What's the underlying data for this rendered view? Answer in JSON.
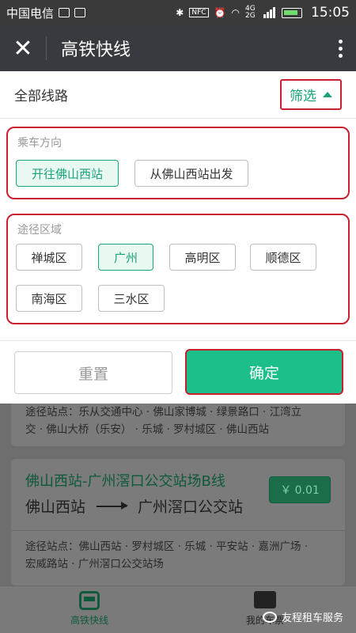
{
  "statusbar": {
    "carrier": "中国电信",
    "network": "4G 2G",
    "time": "15:05"
  },
  "titlebar": {
    "title": "高铁快线"
  },
  "filter": {
    "all_routes": "全部线路",
    "filter_label": "筛选",
    "direction": {
      "title": "乘车方向",
      "options": [
        "开往佛山西站",
        "从佛山西站出发"
      ],
      "selected": "开往佛山西站"
    },
    "area": {
      "title": "途径区域",
      "options": [
        "禅城区",
        "广州",
        "高明区",
        "顺德区",
        "南海区",
        "三水区"
      ],
      "selected": "广州"
    },
    "reset_label": "重置",
    "confirm_label": "确定"
  },
  "routes": [
    {
      "via_line1": "途径站点：乐从交通中心 · 佛山家博城 · 绿景路口 · 江湾立",
      "via_line2": "交 · 佛山大桥（乐安） · 乐城 · 罗村城区 · 佛山西站"
    },
    {
      "name": "佛山西站-广州滘口公交站场B线",
      "price": "￥ 0.01",
      "from": "佛山西站",
      "to": "广州滘口公交站",
      "via_line1": "途径站点：佛山西站 · 罗村城区 · 乐城 · 平安站 · 嘉洲广场 ·",
      "via_line2": "宏威路站 · 广州滘口公交站场"
    }
  ],
  "tabs": [
    {
      "label": "高铁快线",
      "icon": "bus-icon",
      "active": true
    },
    {
      "label": "我的车票",
      "icon": "ticket-icon",
      "active": false
    }
  ],
  "watermark": "友程租车服务"
}
